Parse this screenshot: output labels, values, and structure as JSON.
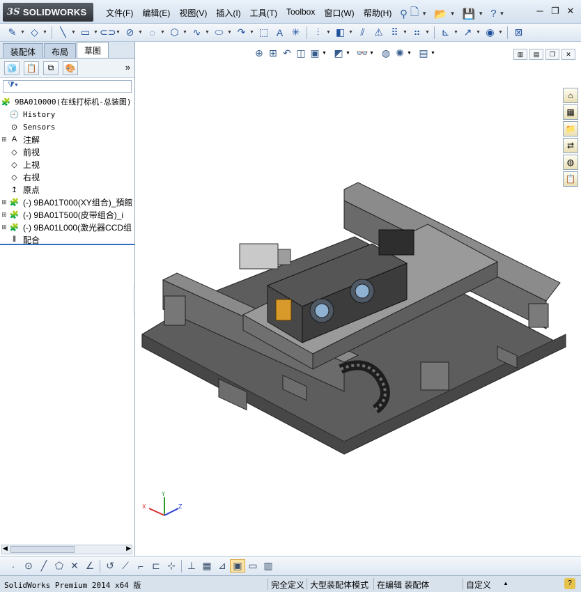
{
  "app": {
    "logo_prefix": "3S",
    "logo_name": "SOLIDWORKS"
  },
  "menu": [
    "文件(F)",
    "编辑(E)",
    "视图(V)",
    "插入(I)",
    "工具(T)",
    "Toolbox",
    "窗口(W)",
    "帮助(H)"
  ],
  "tabs": [
    {
      "label": "装配体",
      "active": false
    },
    {
      "label": "布局",
      "active": false
    },
    {
      "label": "草图",
      "active": true
    }
  ],
  "tree": {
    "root": "9BA010000(在线打标机-总装图)",
    "items": [
      {
        "label": "History",
        "mono": true,
        "expandable": false
      },
      {
        "label": "Sensors",
        "mono": true,
        "expandable": false
      },
      {
        "label": "注解",
        "mono": false,
        "expandable": true
      },
      {
        "label": "前视",
        "mono": false,
        "expandable": false
      },
      {
        "label": "上视",
        "mono": false,
        "expandable": false
      },
      {
        "label": "右视",
        "mono": false,
        "expandable": false
      },
      {
        "label": "原点",
        "mono": false,
        "expandable": false
      },
      {
        "label": "(-) 9BA01T000(XY组合)_預館",
        "mono": false,
        "expandable": true
      },
      {
        "label": "(-) 9BA01T500(皮带组合)_i",
        "mono": false,
        "expandable": true
      },
      {
        "label": "(-) 9BA01L000(激光器CCD组",
        "mono": false,
        "expandable": true
      },
      {
        "label": "配合",
        "mono": false,
        "expandable": false
      }
    ]
  },
  "triad": {
    "x": "X",
    "y": "Y",
    "z": "Z"
  },
  "status": {
    "product": "SolidWorks Premium 2014 x64 版",
    "fully_defined": "完全定义",
    "large_assembly": "大型装配体模式",
    "editing": "在编辑 装配体",
    "custom": "自定义"
  }
}
